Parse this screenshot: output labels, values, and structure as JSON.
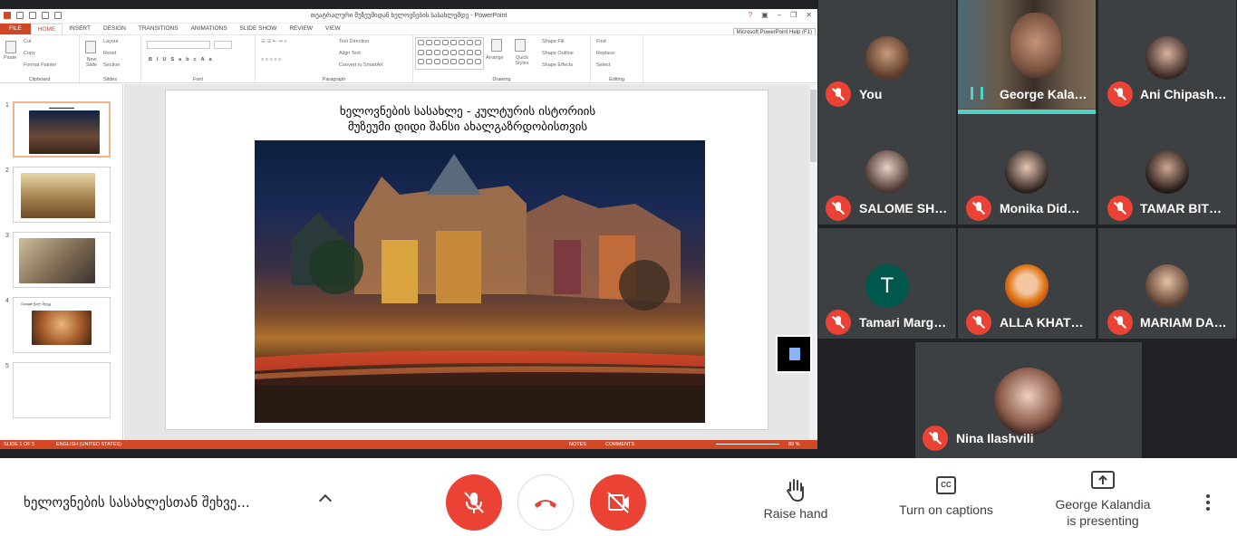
{
  "ppt": {
    "window_title": "თეატრალური მუზეუმიდან ხელოვნების სასახლემდე - PowerPoint",
    "tabs": [
      "FILE",
      "HOME",
      "INSERT",
      "DESIGN",
      "TRANSITIONS",
      "ANIMATIONS",
      "SLIDE SHOW",
      "REVIEW",
      "VIEW"
    ],
    "tooltip": "Microsoft PowerPoint Help (F1)",
    "ribbon": {
      "clipboard": {
        "label": "Clipboard",
        "paste": "Paste",
        "cut": "Cut",
        "copy": "Copy",
        "format_painter": "Format Painter"
      },
      "slides": {
        "label": "Slides",
        "new_slide": "New Slide",
        "layout": "Layout",
        "reset": "Reset",
        "section": "Section"
      },
      "font": {
        "label": "Font"
      },
      "paragraph": {
        "label": "Paragraph",
        "text_direction": "Text Direction",
        "align_text": "Align Text",
        "convert": "Convert to SmartArt"
      },
      "drawing": {
        "label": "Drawing",
        "arrange": "Arrange",
        "quick_styles": "Quick Styles",
        "shape_fill": "Shape Fill",
        "shape_outline": "Shape Outline",
        "shape_effects": "Shape Effects"
      },
      "editing": {
        "label": "Editing",
        "find": "Find",
        "replace": "Replace",
        "select": "Select"
      }
    },
    "thumbnails": [
      "1",
      "2",
      "3",
      "4",
      "5"
    ],
    "thumb4_title": "Google ქალ შდეგ",
    "slide": {
      "title_line1": "ხელოვნების სასახლე - კულტურის ისტორიის",
      "title_line2": "მუზეუმი   დიდი შანსი ახალგაზრდობისთვის"
    },
    "status": {
      "slide": "SLIDE 1 OF 5",
      "language": "ENGLISH (UNITED STATES)",
      "notes": "NOTES",
      "comments": "COMMENTS",
      "zoom": "89 %"
    }
  },
  "participants": [
    {
      "name": "You",
      "muted": true
    },
    {
      "name": "George Kala…",
      "speaking": true
    },
    {
      "name": "Ani Chipash…",
      "muted": true
    },
    {
      "name": "SALOME SH…",
      "muted": true
    },
    {
      "name": "Monika Did…",
      "muted": true
    },
    {
      "name": "TAMAR BIT…",
      "muted": true
    },
    {
      "name": "Tamari Marg…",
      "initial": "T",
      "muted": true
    },
    {
      "name": "ALLA KHAT…",
      "muted": true
    },
    {
      "name": "MARIAM DA…",
      "muted": true
    },
    {
      "name": "Nina Ilashvili",
      "muted": true
    }
  ],
  "bottom_bar": {
    "meeting_title": "ხელოვნების სასახლესთან შეხვე...",
    "raise_hand": "Raise hand",
    "captions": "Turn on captions",
    "presenting_line1": "George Kalandia",
    "presenting_line2": "is presenting",
    "captions_icon_text": "CC"
  },
  "colors": {
    "ppt_accent": "#d24726",
    "meet_red": "#ea4335",
    "speaking_bar": "#4fd1c5"
  }
}
